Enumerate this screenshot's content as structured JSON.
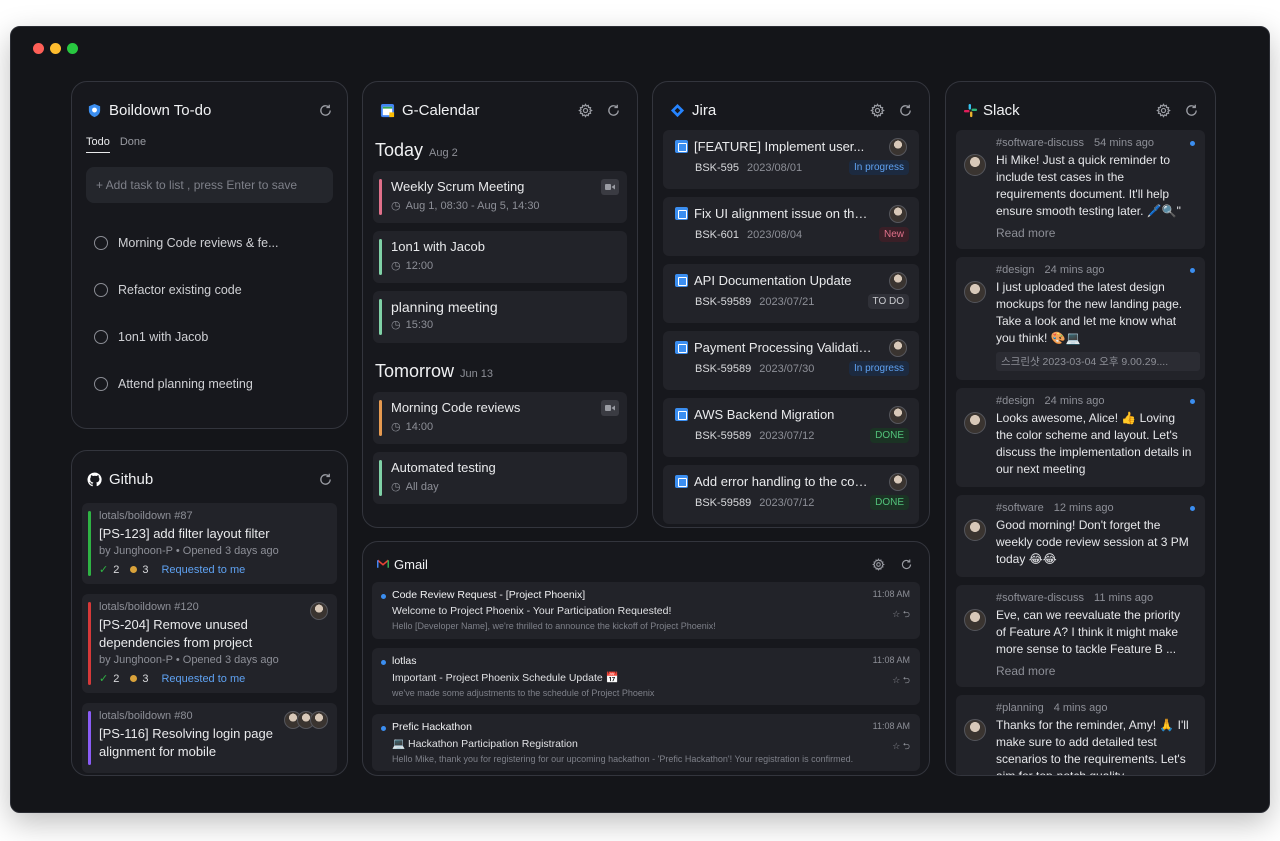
{
  "todo": {
    "title": "Boildown To-do",
    "tabs": [
      "Todo",
      "Done"
    ],
    "input_placeholder": "+ Add task to list , press Enter to save",
    "items": [
      "Morning Code reviews & fe...",
      "Refactor existing code",
      "1on1 with Jacob",
      "Attend planning meeting"
    ]
  },
  "github": {
    "title": "Github",
    "items": [
      {
        "repo": "lotals/boildown  #87",
        "title": "[PS-123] add filter layout filter",
        "meta": "by Junghoon-P • Opened 3 days ago",
        "checks": "2",
        "comments": "3",
        "req": "Requested to me",
        "color": "#2fb344"
      },
      {
        "repo": "lotals/boildown  #120",
        "title": "[PS-204] Remove unused dependencies from project",
        "meta": "by Junghoon-P • Opened 3 days ago",
        "checks": "2",
        "comments": "3",
        "req": "Requested to me",
        "color": "#d63939"
      },
      {
        "repo": "lotals/boildown  #80",
        "title": "[PS-116] Resolving login page alignment for mobile",
        "meta": "",
        "checks": "",
        "comments": "",
        "req": "",
        "color": "#8a5cf6"
      }
    ]
  },
  "calendar": {
    "title": "G-Calendar",
    "days": [
      {
        "label": "Today",
        "date": "Aug 2",
        "events": [
          {
            "title": "Weekly Scrum Meeting",
            "time": "Aug 1, 08:30 - Aug 5, 14:30",
            "color": "#e0708a",
            "video": true
          },
          {
            "title": "1on1 with Jacob",
            "time": "12:00",
            "color": "#7fd1a6",
            "video": false
          },
          {
            "title": "planning meeting",
            "time": "15:30",
            "color": "#7fd1a6",
            "video": false
          }
        ]
      },
      {
        "label": "Tomorrow",
        "date": "Jun 13",
        "events": [
          {
            "title": "Morning Code reviews",
            "time": "14:00",
            "color": "#e69a50",
            "video": true
          },
          {
            "title": "Automated testing",
            "time": "All day",
            "color": "#7fd1a6",
            "video": false
          }
        ]
      }
    ]
  },
  "jira": {
    "title": "Jira",
    "items": [
      {
        "title": "[FEATURE] Implement user...",
        "key": "BSK-595",
        "date": "2023/08/01",
        "status": "In progress",
        "status_color": "#5fa2f2",
        "status_bg": "#1c2a40"
      },
      {
        "title": "Fix UI alignment issue on the...",
        "key": "BSK-601",
        "date": "2023/08/04",
        "status": "New",
        "status_color": "#e0708a",
        "status_bg": "#3a1f27"
      },
      {
        "title": "API Documentation Update",
        "key": "BSK-59589",
        "date": "2023/07/21",
        "status": "TO DO",
        "status_color": "#c8c9cd",
        "status_bg": "#303138"
      },
      {
        "title": "Payment Processing Validation",
        "key": "BSK-59589",
        "date": "2023/07/30",
        "status": "In progress",
        "status_color": "#5fa2f2",
        "status_bg": "#1c2a40"
      },
      {
        "title": "AWS Backend Migration",
        "key": "BSK-59589",
        "date": "2023/07/12",
        "status": "DONE",
        "status_color": "#52c27a",
        "status_bg": "#1b3324"
      },
      {
        "title": "Add error handling to the con...",
        "key": "BSK-59589",
        "date": "2023/07/12",
        "status": "DONE",
        "status_color": "#52c27a",
        "status_bg": "#1b3324"
      }
    ]
  },
  "gmail": {
    "title": "Gmail",
    "items": [
      {
        "from": "Code Review Request - [Project Phoenix]",
        "subject": "Welcome to Project Phoenix - Your Participation Requested!",
        "preview": "Hello [Developer Name], we're thrilled to announce the kickoff of Project Phoenix!",
        "time": "11:08 AM"
      },
      {
        "from": "lotlas",
        "subject": "Important - Project Phoenix Schedule Update 📅",
        "preview": "we've made some adjustments to the schedule of Project Phoenix",
        "time": "11:08 AM"
      },
      {
        "from": "Prefic Hackathon",
        "subject": "💻 Hackathon Participation Registration",
        "preview": "Hello Mike, thank you for registering for our upcoming hackathon - 'Prefic Hackathon'! Your registration is confirmed.",
        "time": "11:08 AM"
      }
    ]
  },
  "slack": {
    "title": "Slack",
    "items": [
      {
        "channel": "#software-discuss",
        "ago": "54 mins ago",
        "text": "Hi Mike! Just a quick reminder to include test cases in the requirements document. It'll help ensure smooth testing later. 🖊️🔍\"",
        "more": "Read more",
        "attach": ""
      },
      {
        "channel": "#design",
        "ago": "24 mins ago",
        "text": "I just uploaded the latest design mockups for the new landing page. Take a look and let me know what you think! 🎨💻",
        "more": "",
        "attach": "스크린샷 2023-03-04 오후 9.00.29...."
      },
      {
        "channel": "#design",
        "ago": "24 mins ago",
        "text": "Looks awesome, Alice! 👍 Loving the color scheme and layout. Let's discuss the implementation details in our next meeting",
        "more": "",
        "attach": ""
      },
      {
        "channel": "#software",
        "ago": "12 mins ago",
        "text": "Good morning! Don't forget the weekly code review session at 3 PM today 😂😂",
        "more": "",
        "attach": ""
      },
      {
        "channel": "#software-discuss",
        "ago": "11 mins ago",
        "text": "Eve, can we reevaluate the priority of Feature A? I think it might make more sense to tackle Feature B ...",
        "more": "Read more",
        "attach": ""
      },
      {
        "channel": "#planning",
        "ago": "4 mins ago",
        "text": "Thanks for the reminder, Amy! 🙏 I'll make sure to add detailed test scenarios to the requirements. Let's aim for top-notch quality",
        "more": "",
        "attach": ""
      }
    ]
  }
}
